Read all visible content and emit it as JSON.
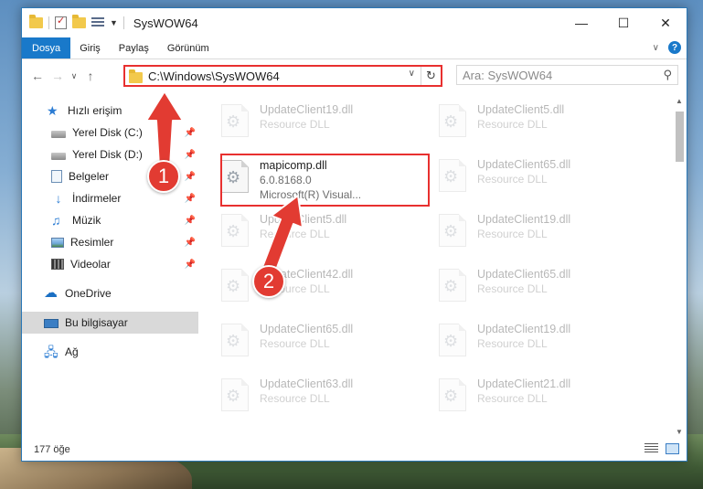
{
  "window": {
    "title": "SysWOW64"
  },
  "ribbon": {
    "tabs": [
      "Dosya",
      "Giriş",
      "Paylaş",
      "Görünüm"
    ]
  },
  "address": {
    "path": "C:\\Windows\\SysWOW64"
  },
  "search": {
    "placeholder": "Ara: SysWOW64"
  },
  "sidebar": {
    "items": [
      {
        "label": "Hızlı erişim",
        "icon": "star-icon"
      },
      {
        "label": "Yerel Disk (C:)",
        "icon": "drive-icon",
        "pinned": true
      },
      {
        "label": "Yerel Disk (D:)",
        "icon": "drive-icon",
        "pinned": true
      },
      {
        "label": "Belgeler",
        "icon": "document-icon",
        "pinned": true
      },
      {
        "label": "İndirmeler",
        "icon": "download-icon",
        "pinned": true
      },
      {
        "label": "Müzik",
        "icon": "music-icon",
        "pinned": true
      },
      {
        "label": "Resimler",
        "icon": "pictures-icon",
        "pinned": true
      },
      {
        "label": "Videolar",
        "icon": "video-icon",
        "pinned": true
      },
      {
        "label": "OneDrive",
        "icon": "cloud-icon"
      },
      {
        "label": "Bu bilgisayar",
        "icon": "computer-icon",
        "selected": true
      },
      {
        "label": "Ağ",
        "icon": "network-icon"
      }
    ]
  },
  "files": {
    "left": [
      {
        "name": "UpdateClient19.dll",
        "sub": "Resource DLL"
      },
      {
        "name": "mapicomp.dll",
        "version": "6.0.8168.0",
        "company": "Microsoft(R) Visual..."
      },
      {
        "name": "UpdateClient5.dll",
        "sub": "Resource DLL"
      },
      {
        "name": "UpdateClient42.dll",
        "sub": "Resource DLL"
      },
      {
        "name": "UpdateClient65.dll",
        "sub": "Resource DLL"
      },
      {
        "name": "UpdateClient63.dll",
        "sub": "Resource DLL"
      }
    ],
    "right": [
      {
        "name": "UpdateClient5.dll",
        "sub": "Resource DLL"
      },
      {
        "name": "UpdateClient65.dll",
        "sub": "Resource DLL"
      },
      {
        "name": "UpdateClient19.dll",
        "sub": "Resource DLL"
      },
      {
        "name": "UpdateClient65.dll",
        "sub": "Resource DLL"
      },
      {
        "name": "UpdateClient19.dll",
        "sub": "Resource DLL"
      },
      {
        "name": "UpdateClient21.dll",
        "sub": "Resource DLL"
      }
    ]
  },
  "status": {
    "count": "177 öğe"
  },
  "annotations": {
    "badge1": "1",
    "badge2": "2",
    "color": "#e23b32"
  }
}
